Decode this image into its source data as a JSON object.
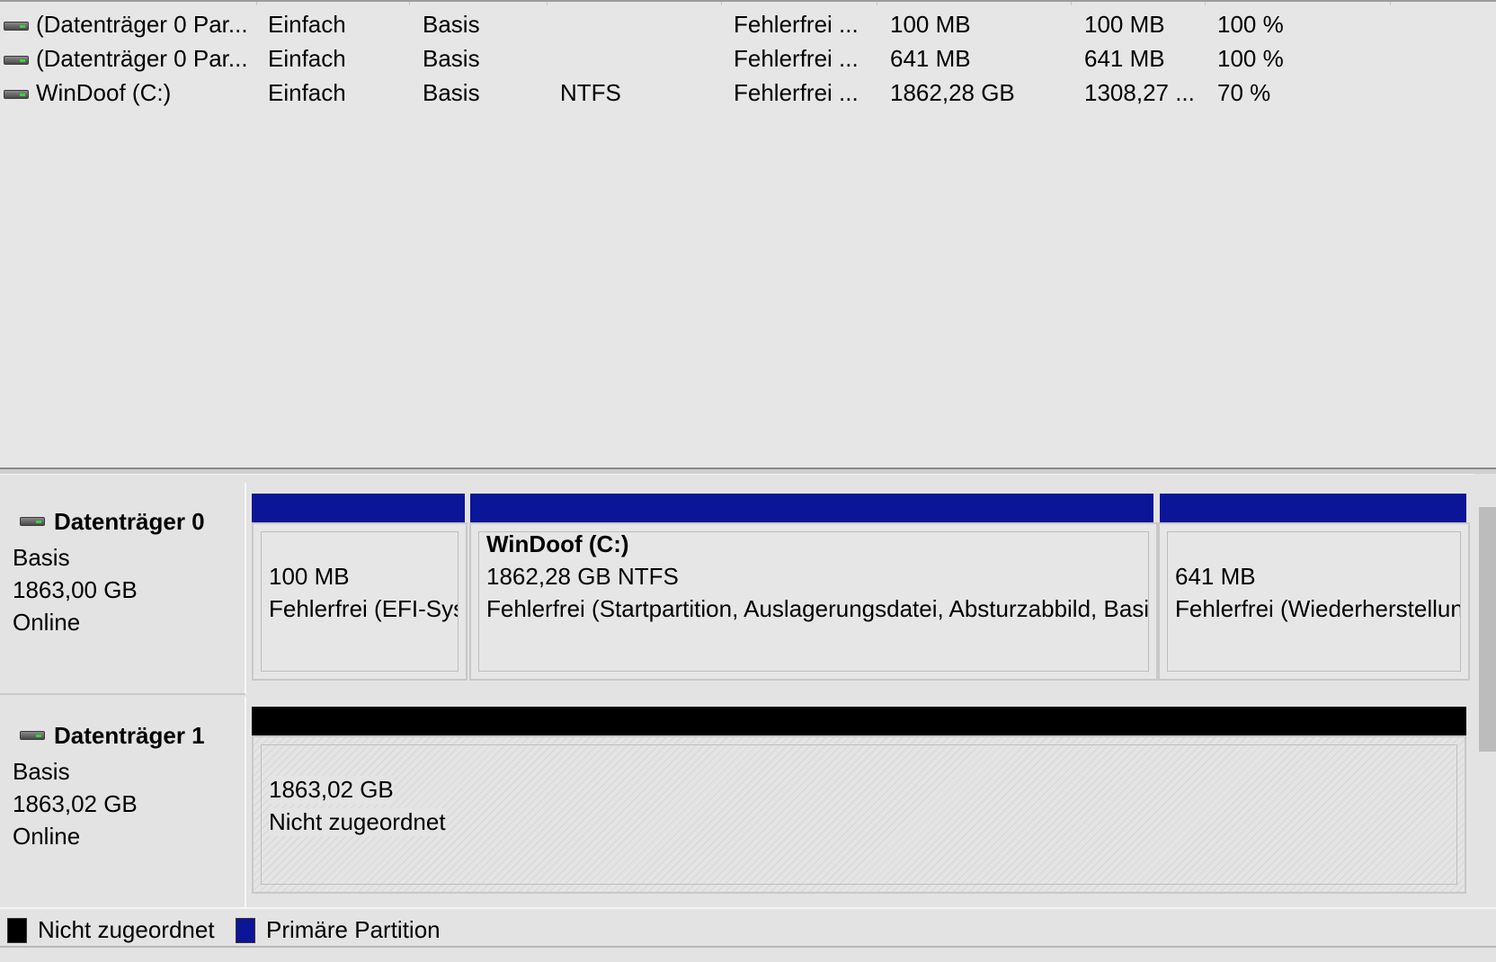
{
  "volumes": [
    {
      "icon": "drive-icon",
      "volume": "(Datenträger 0 Par...",
      "layout": "Einfach",
      "type": "Basis",
      "filesystem": "",
      "status": "Fehlerfrei ...",
      "capacity": "100 MB",
      "free": "100 MB",
      "free_pct": "100 %"
    },
    {
      "icon": "drive-icon",
      "volume": "(Datenträger 0 Par...",
      "layout": "Einfach",
      "type": "Basis",
      "filesystem": "",
      "status": "Fehlerfrei ...",
      "capacity": "641 MB",
      "free": "641 MB",
      "free_pct": "100 %"
    },
    {
      "icon": "drive-icon",
      "volume": "WinDoof (C:)",
      "layout": "Einfach",
      "type": "Basis",
      "filesystem": "NTFS",
      "status": "Fehlerfrei ...",
      "capacity": "1862,28 GB",
      "free": "1308,27 ...",
      "free_pct": "70 %"
    }
  ],
  "disks": [
    {
      "name": "Datenträger 0",
      "type": "Basis",
      "size": "1863,00 GB",
      "state": "Online",
      "partitions": [
        {
          "title": "",
          "size": "100 MB",
          "status": "Fehlerfrei (EFI-System"
        },
        {
          "title": "WinDoof  (C:)",
          "size": "1862,28 GB NTFS",
          "status": "Fehlerfrei (Startpartition, Auslagerungsdatei, Absturzabbild, Basisdatenpartition)"
        },
        {
          "title": "",
          "size": "641 MB",
          "status": "Fehlerfrei (Wiederherstellungspartition)"
        }
      ]
    },
    {
      "name": "Datenträger 1",
      "type": "Basis",
      "size": "1863,02 GB",
      "state": "Online",
      "partitions": [
        {
          "title": "",
          "size": "1863,02 GB",
          "status": "Nicht zugeordnet"
        }
      ]
    }
  ],
  "legend": [
    {
      "label": "Nicht zugeordnet",
      "color": "#000000"
    },
    {
      "label": "Primäre Partition",
      "color": "#0b1597"
    }
  ],
  "colors": {
    "primary_partition": "#0b1597",
    "unallocated": "#000000"
  }
}
